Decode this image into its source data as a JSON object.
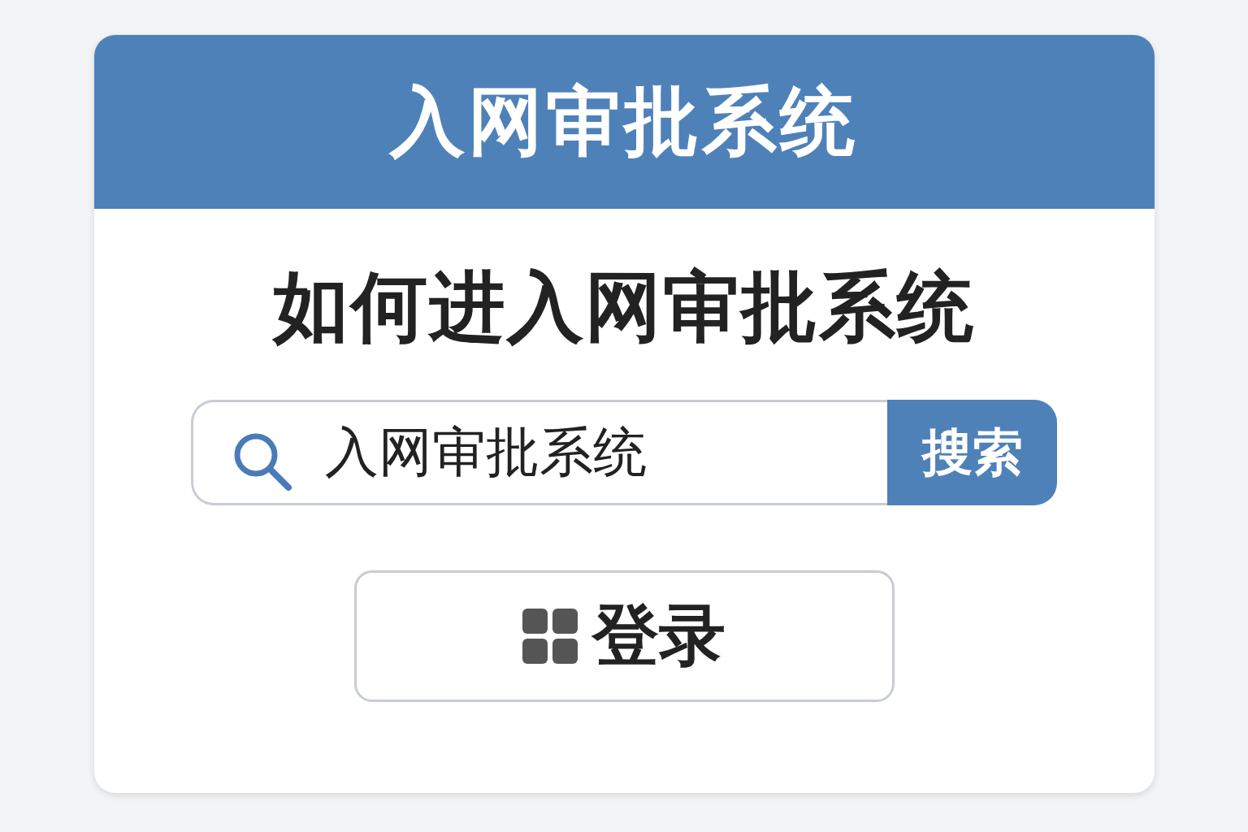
{
  "header": {
    "title": "入网审批系统"
  },
  "heading": "如何进入网审批系统",
  "search": {
    "value": "入网审批系统",
    "button": "搜索"
  },
  "login_button": "登录"
}
